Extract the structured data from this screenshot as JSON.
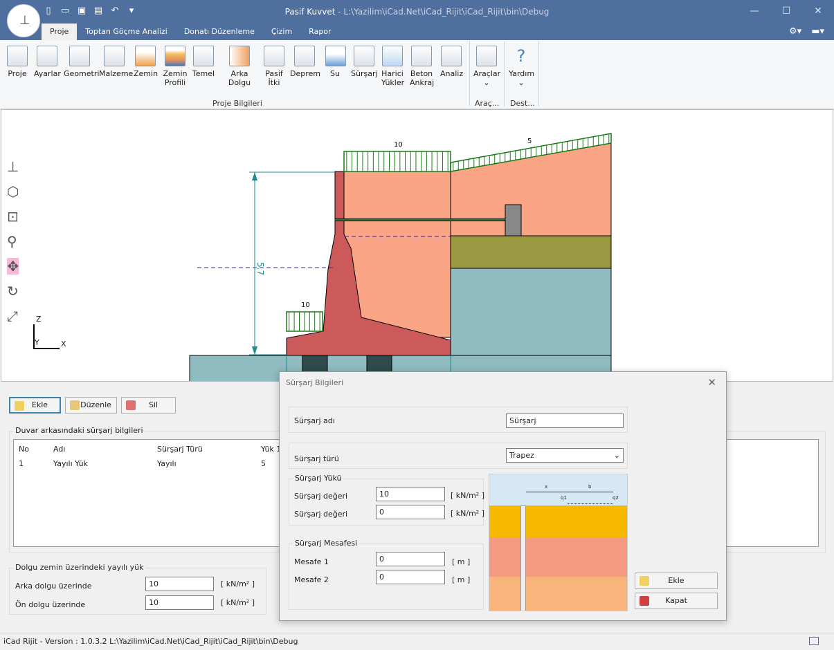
{
  "window": {
    "title": "Pasif Kuvvet",
    "separator": " - ",
    "path": "L:\\Yazilim\\iCad.Net\\iCad_Rijit\\iCad_Rijit\\bin\\Debug"
  },
  "tabs": [
    "Proje",
    "Toptan Göçme Analizi",
    "Donatı Düzenleme",
    "Çizim",
    "Rapor"
  ],
  "ribbon": {
    "buttons": [
      "Proje",
      "Ayarlar",
      "Geometri",
      "Malzeme",
      "Zemin",
      "Zemin\nProfili",
      "Temel",
      "Arka Dolgu",
      "Pasif\nİtki",
      "Deprem",
      "Su",
      "Sürşarj",
      "Harici\nYükler",
      "Beton\nAnkraj",
      "Analiz"
    ],
    "group_label": "Proje Bilgileri",
    "tools_label": "Araçlar",
    "tools_group": "Araç...",
    "help_label": "Yardım",
    "help_group": "Dest..."
  },
  "drawing": {
    "load_back": "10",
    "load_slope": "5",
    "load_front": "10",
    "height_label": "5.7",
    "axis_z": "Z",
    "axis_y": "Y",
    "axis_x": "X"
  },
  "toolbar": {
    "add": "Ekle",
    "edit": "Düzenle",
    "delete": "Sil"
  },
  "table": {
    "title": "Duvar arkasındaki sürşarj bilgileri",
    "headers": [
      "No",
      "Adı",
      "Sürşarj Türü",
      "Yük 1"
    ],
    "rows": [
      [
        "1",
        "Yayılı Yük",
        "Yayılı",
        "5"
      ]
    ]
  },
  "fill_loads": {
    "title": "Dolgu zemin üzerindeki yayılı yük",
    "back_label": "Arka dolgu üzerinde",
    "back_value": "10",
    "front_label": "Ön dolgu üzerinde",
    "front_value": "10",
    "unit": "[ kN/m² ]"
  },
  "dialog": {
    "title": "Sürşarj Bilgileri",
    "name_label": "Sürşarj adı",
    "name_value": "Sürşarj",
    "type_label": "Sürşarj türü",
    "type_value": "Trapez",
    "load_group": "Sürşarj Yükü",
    "load1_label": "Sürşarj değeri",
    "load1_value": "10",
    "load2_label": "Sürşarj değeri",
    "load2_value": "0",
    "load_unit": "[ kN/m² ]",
    "dist_group": "Sürşarj Mesafesi",
    "dist1_label": "Mesafe 1",
    "dist1_value": "0",
    "dist2_label": "Mesafe 2",
    "dist2_value": "0",
    "dist_unit": "[ m ]",
    "add": "Ekle",
    "close": "Kapat",
    "sketch": {
      "x": "x",
      "b": "b",
      "q1": "q1",
      "q2": "q2"
    }
  },
  "status": "iCad Rijit - Version : 1.0.3.2  L:\\Yazilim\\iCad.Net\\iCad_Rijit\\iCad_Rijit\\bin\\Debug"
}
